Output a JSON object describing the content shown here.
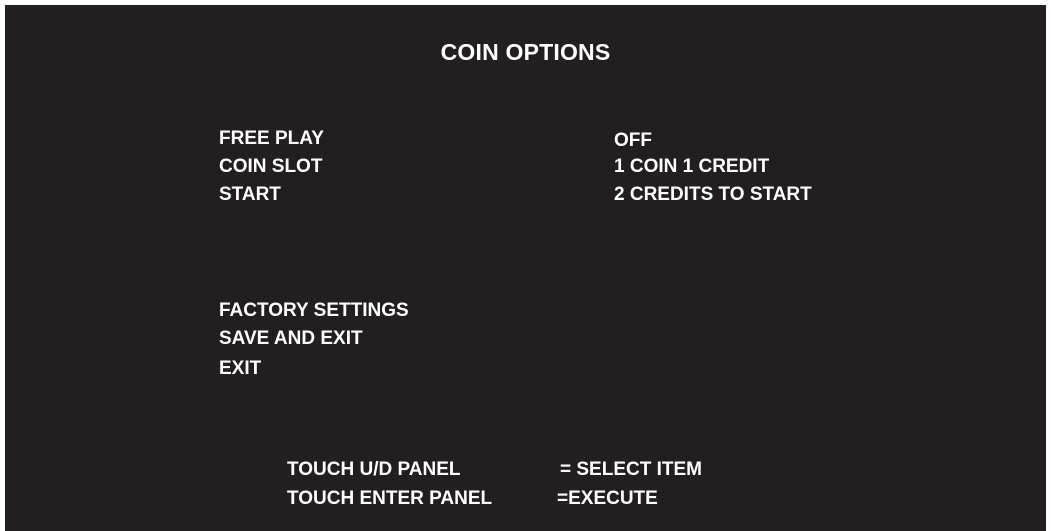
{
  "title": "COIN OPTIONS",
  "settings": [
    {
      "label": "FREE PLAY",
      "value": "OFF"
    },
    {
      "label": "COIN SLOT",
      "value": "1 COIN 1 CREDIT"
    },
    {
      "label": "START",
      "value": "2 CREDITS TO START"
    }
  ],
  "actions": [
    {
      "label": "FACTORY SETTINGS"
    },
    {
      "label": "SAVE AND EXIT"
    },
    {
      "label": "EXIT"
    }
  ],
  "help": [
    {
      "key": "TOUCH U/D PANEL",
      "desc": "= SELECT ITEM"
    },
    {
      "key": "TOUCH ENTER PANEL",
      "desc": "=EXECUTE"
    }
  ],
  "colors": {
    "background": "#231f20",
    "text": "#ffffff"
  }
}
